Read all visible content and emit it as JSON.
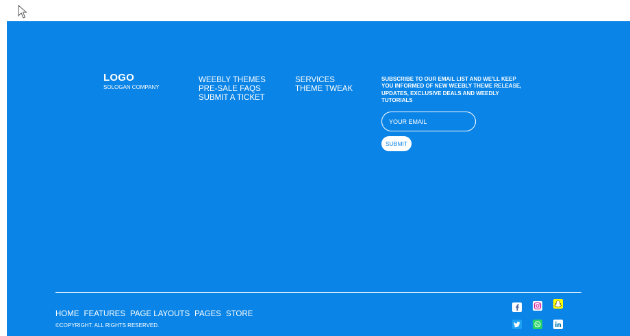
{
  "footer": {
    "logo": "LOGO",
    "slogan": "SOLOGAN COMPANY",
    "links_col1": [
      "WEEBLY THEMES",
      "PRE-SALE FAQS",
      "SUBMIT A TICKET"
    ],
    "links_col2": [
      "SERVICES",
      "THEME TWEAK"
    ],
    "subscribe_text": "SUBSCRIBE TO OUR EMAIL LIST AND WE'LL KEEP YOU INFORMED OF NEW WEEBLY THEME RELEASE, UPDATES, EXCLUSIVE DEALS AND WEEDLY TUTORIALS",
    "email_placeholder": "YOUR EMAIL",
    "submit_label": "SUBMIT",
    "bottom_nav": [
      "HOME",
      "FEATURES",
      "PAGE LAYOUTS",
      "PAGES",
      "STORE"
    ],
    "copyright": "©COPYRIGHT. ALL RIGHTS RESERVED.",
    "social_icons": [
      "facebook-icon",
      "instagram-icon",
      "snapchat-icon",
      "twitter-icon",
      "whatsapp-icon",
      "linkedin-icon"
    ]
  },
  "colors": {
    "background": "#0a84e6",
    "text": "#ffffff"
  }
}
